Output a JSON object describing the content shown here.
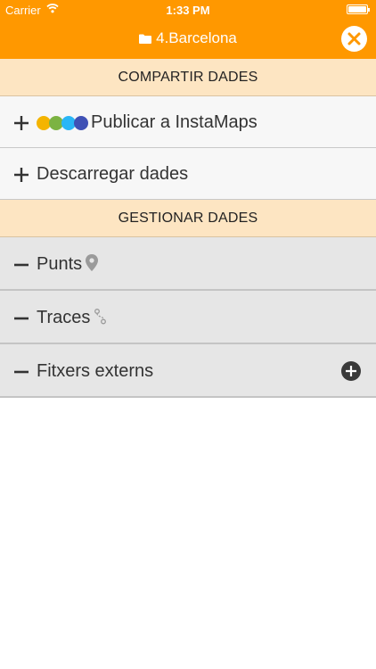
{
  "status": {
    "carrier": "Carrier",
    "time": "1:33 PM"
  },
  "nav": {
    "title": "4.Barcelona"
  },
  "sections": [
    {
      "label": "COMPARTIR DADES"
    },
    {
      "label": "GESTIONAR DADES"
    }
  ],
  "rows": {
    "publish": {
      "label": "Publicar a InstaMaps"
    },
    "download": {
      "label": "Descarregar dades"
    },
    "points": {
      "label": "Punts"
    },
    "traces": {
      "label": "Traces"
    },
    "external": {
      "label": "Fitxers externs"
    }
  },
  "colors": {
    "accent": "#ff9800",
    "section_bg": "#fde5c2",
    "instamaps": [
      "#f4b400",
      "#7cb342",
      "#29b6f6",
      "#3f51b5"
    ]
  },
  "icons": [
    "wifi-icon",
    "battery-icon",
    "folder-icon",
    "close-icon",
    "plus-icon",
    "minus-icon",
    "map-pin-icon",
    "route-icon",
    "add-circle-icon"
  ]
}
